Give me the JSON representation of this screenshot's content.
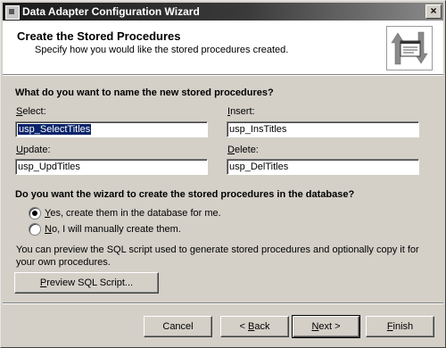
{
  "window": {
    "title": "Data Adapter Configuration Wizard",
    "close_glyph": "×",
    "icon": "wizard-app-icon"
  },
  "header": {
    "title": "Create the Stored Procedures",
    "subtitle": "Specify how you would like the stored procedures created.",
    "graphic_icon": "stored-procedure-arrows-icon"
  },
  "names_section": {
    "heading": "What do you want to name the new stored procedures?",
    "select": {
      "label_key": "S",
      "label_rest": "elect:",
      "value": "usp_SelectTitles"
    },
    "insert": {
      "label_key": "I",
      "label_rest": "nsert:",
      "value": "usp_InsTitles"
    },
    "update": {
      "label_key": "U",
      "label_rest": "pdate:",
      "value": "usp_UpdTitles"
    },
    "delete": {
      "label_key": "D",
      "label_rest": "elete:",
      "value": "usp_DelTitles"
    }
  },
  "create_section": {
    "heading": "Do you want the wizard to create the stored procedures in the database?",
    "option_yes": {
      "key": "Y",
      "rest": "es, create them in the database for me.",
      "checked": true
    },
    "option_no": {
      "key": "N",
      "rest": "o, I will manually create them.",
      "checked": false
    }
  },
  "preview_section": {
    "text_line1": "You can preview the SQL script used to generate stored procedures and optionally copy it for",
    "text_line2": "your own procedures.",
    "button_key": "P",
    "button_rest": "review SQL Script..."
  },
  "footer": {
    "cancel": "Cancel",
    "back_pre": "< ",
    "back_key": "B",
    "back_rest": "ack",
    "next_key": "N",
    "next_rest": "ext >",
    "finish_key": "F",
    "finish_rest": "inish"
  }
}
